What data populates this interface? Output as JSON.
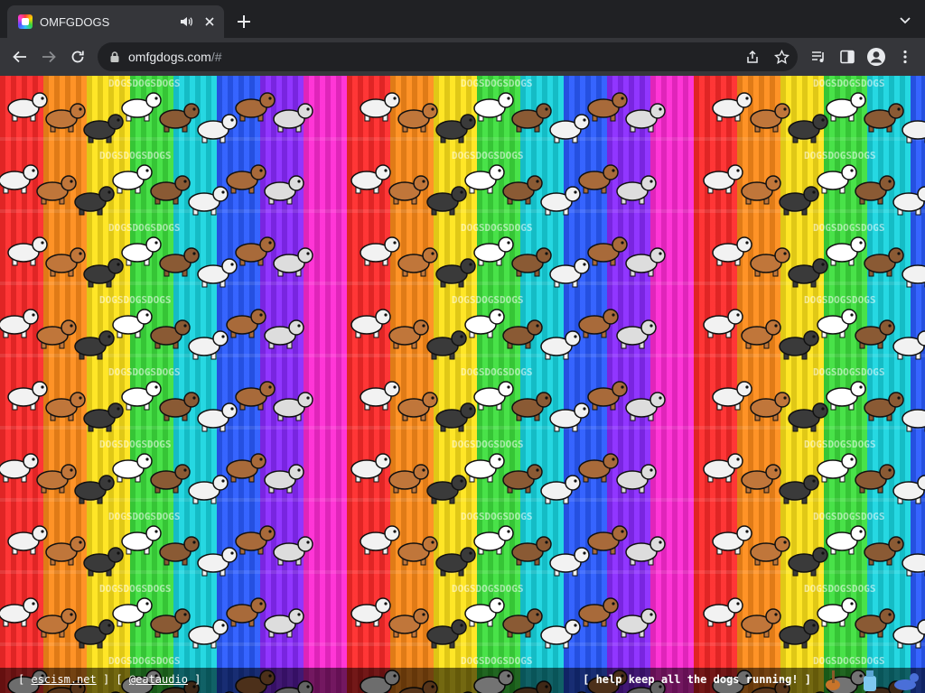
{
  "browser": {
    "tab": {
      "title": "OMFGDOGS",
      "favicon": "rainbow-dog-favicon",
      "audio_icon": "speaker-icon",
      "close_icon": "close-icon"
    },
    "new_tab_icon": "plus-icon",
    "tab_search_icon": "chevron-down-icon",
    "toolbar": {
      "back_icon": "arrow-left-icon",
      "forward_icon": "arrow-right-icon",
      "reload_icon": "reload-icon",
      "share_icon": "share-icon",
      "bookmark_icon": "star-icon",
      "media_icon": "media-control-icon",
      "side_panel_icon": "side-panel-icon",
      "profile_icon": "profile-icon",
      "menu_icon": "kebab-menu-icon"
    },
    "omnibox": {
      "domain": "omfgdogs.com",
      "path": "/#",
      "lock_icon": "lock-icon"
    }
  },
  "page": {
    "background_colors": [
      "#ff2a2a",
      "#ff8c1a",
      "#ffe41a",
      "#3ee03e",
      "#18d6e0",
      "#2a5bff",
      "#8a2aff",
      "#ff2ad4"
    ],
    "tile_text": "DOGS",
    "footer": {
      "bracket_open": "[",
      "bracket_close": "]",
      "link1": "escism.net",
      "link2": "@eataudio",
      "right_text": "[ help keep all the dogs running! ]",
      "support_icons": [
        "guitar-icon",
        "donate-bottle-icon",
        "dog-icon"
      ]
    }
  }
}
